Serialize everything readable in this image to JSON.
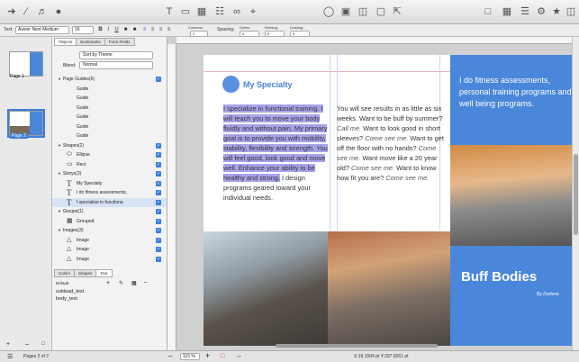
{
  "toolbar": {
    "left_icons": [
      "pointer-tool-icon",
      "line-tool-icon",
      "audio-icon",
      "color-icon"
    ],
    "center_icons": [
      "text-tool-icon",
      "shape-tool-icon",
      "image-tool-icon",
      "table-tool-icon",
      "link-icon",
      "crop-icon"
    ],
    "right_icons": [
      "view-icon",
      "layout-icon",
      "sidebar-icon",
      "fullscreen-icon",
      "share-icon",
      "settings-icon",
      "inspector-icon",
      "help-icon"
    ]
  },
  "format_bar": {
    "text_label": "Text:",
    "font": "Avenir Next Medium",
    "size": "16",
    "bold": "B",
    "italic": "I",
    "underline": "U",
    "columns_label": "Columns:",
    "columns_value": "2",
    "spacing_label": "Spacing:",
    "spacing_value": "0",
    "gutter_label": "Gutter:",
    "gutter_value": "0",
    "kerning_label": "Kerning:",
    "kerning_value": "0",
    "leading_label": "Leading:",
    "leading_value": "0"
  },
  "thumbnails": [
    {
      "label": "Page 1"
    },
    {
      "label": "Page 2"
    }
  ],
  "panel": {
    "tabs": [
      "Objects",
      "Bookmarks",
      "Form Fields"
    ],
    "sort": "Sort by Theme",
    "blend_label": "Blend:",
    "blend_value": "Normal",
    "tree": [
      {
        "label": "Page Guides(6)",
        "indent": 0,
        "icon": "",
        "checked": true
      },
      {
        "label": "Guide",
        "indent": 2,
        "icon": "",
        "checked": false
      },
      {
        "label": "Guide",
        "indent": 2,
        "icon": "",
        "checked": false
      },
      {
        "label": "Guide",
        "indent": 2,
        "icon": "",
        "checked": false
      },
      {
        "label": "Guide",
        "indent": 2,
        "icon": "",
        "checked": false
      },
      {
        "label": "Guide",
        "indent": 2,
        "icon": "",
        "checked": false
      },
      {
        "label": "Guide",
        "indent": 2,
        "icon": "",
        "checked": false
      },
      {
        "label": "Shapes(2)",
        "indent": 0,
        "icon": "",
        "checked": true
      },
      {
        "label": "Ellipse",
        "indent": 2,
        "icon": "ellipse",
        "checked": true
      },
      {
        "label": "Rect",
        "indent": 2,
        "icon": "rect",
        "checked": true
      },
      {
        "label": "Storys(3)",
        "indent": 0,
        "icon": "",
        "checked": true
      },
      {
        "label": "My Specialty",
        "indent": 2,
        "icon": "T",
        "checked": true
      },
      {
        "label": "I do fitness assessments,",
        "indent": 2,
        "icon": "T",
        "checked": true
      },
      {
        "label": "I specialize in functiona",
        "indent": 2,
        "icon": "T",
        "checked": true,
        "selected": true
      },
      {
        "label": "Groups(1)",
        "indent": 0,
        "icon": "",
        "checked": true
      },
      {
        "label": "Grouped",
        "indent": 2,
        "icon": "group",
        "checked": true
      },
      {
        "label": "Images(3)",
        "indent": 0,
        "icon": "",
        "checked": true
      },
      {
        "label": "Image",
        "indent": 2,
        "icon": "image",
        "checked": true
      },
      {
        "label": "Image",
        "indent": 2,
        "icon": "image",
        "checked": true
      },
      {
        "label": "Image",
        "indent": 2,
        "icon": "image",
        "checked": true
      }
    ],
    "bottom_tabs": [
      "Colors",
      "Shapes",
      "Text"
    ],
    "style_default": "Default",
    "styles": [
      "sublead_text",
      "body_text"
    ]
  },
  "page": {
    "heading": "My Specialty",
    "body_highlighted": "I specialize in functional training.  I will teach you to move your body fluidly and without pain.  My primary goal is to provide you with mobility, stability, flexibility and strength.  You will feel good, look good and move well. Enhance your ability to be healthy and strong.",
    "body_rest": "I design programs geared toward your individual needs.",
    "column2": [
      {
        "text": "You will see results in as little as six weeks. Want to be buff by summer? ",
        "italic": false
      },
      {
        "text": "Call me.",
        "italic": true
      },
      {
        "text": "  Want to look good in short sleeves? ",
        "italic": false
      },
      {
        "text": "Come see me.",
        "italic": true
      },
      {
        "text": "  Want to get off the floor with no hands? ",
        "italic": false
      },
      {
        "text": "Come see me.",
        "italic": true
      },
      {
        "text": "  Want move like a 20 year old? ",
        "italic": false
      },
      {
        "text": "Come see me.",
        "italic": true
      },
      {
        "text": "  Want to know how fit you are? ",
        "italic": false
      },
      {
        "text": "Come see me.",
        "italic": true
      }
    ],
    "promo": "I do fitness assessments, personal training programs and well being programs.",
    "brand": "Buff Bodies",
    "byline": "By Darlene"
  },
  "status": {
    "pages": "Pages 2 of 2",
    "zoom": "115 %",
    "coords": "X:19.1504 pt    Y:337.8261 pt"
  },
  "colors": {
    "accent_blue": "#4a87db",
    "highlight": "#a7a3ea"
  }
}
